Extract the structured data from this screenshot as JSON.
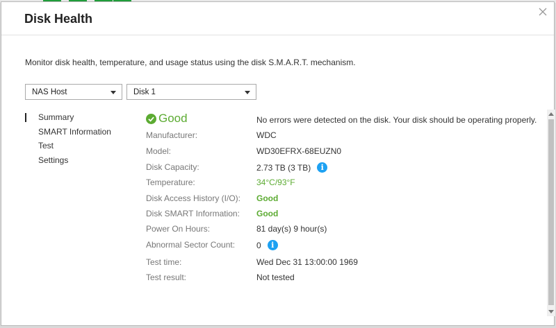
{
  "dialog": {
    "title": "Disk Health",
    "description": "Monitor disk health, temperature, and usage status using the disk S.M.A.R.T. mechanism."
  },
  "selectors": {
    "host": "NAS Host",
    "disk": "Disk 1"
  },
  "nav": {
    "items": [
      "Summary",
      "SMART Information",
      "Test",
      "Settings"
    ],
    "active": "Summary"
  },
  "summary": {
    "status": "Good",
    "status_message": "No errors were detected on the disk. Your disk should be operating properly.",
    "rows": [
      {
        "label": "Manufacturer:",
        "value": "WDC"
      },
      {
        "label": "Model:",
        "value": "WD30EFRX-68EUZN0"
      },
      {
        "label": "Disk Capacity:",
        "value": "2.73 TB (3 TB)"
      },
      {
        "label": "Temperature:",
        "value": "34°C/93°F"
      },
      {
        "label": "Disk Access History (I/O):",
        "value": "Good"
      },
      {
        "label": "Disk SMART Information:",
        "value": "Good"
      },
      {
        "label": "Power On Hours:",
        "value": "81 day(s) 9 hour(s)"
      },
      {
        "label": "Abnormal Sector Count:",
        "value": "0"
      },
      {
        "label": "Test time:",
        "value": "Wed Dec 31 13:00:00 1969"
      },
      {
        "label": "Test result:",
        "value": "Not tested"
      }
    ]
  },
  "icons": {
    "info": "info-icon",
    "status": "check-circle-icon",
    "close": "close-icon"
  },
  "colors": {
    "good": "#5cab32",
    "info": "#1da1f2"
  }
}
